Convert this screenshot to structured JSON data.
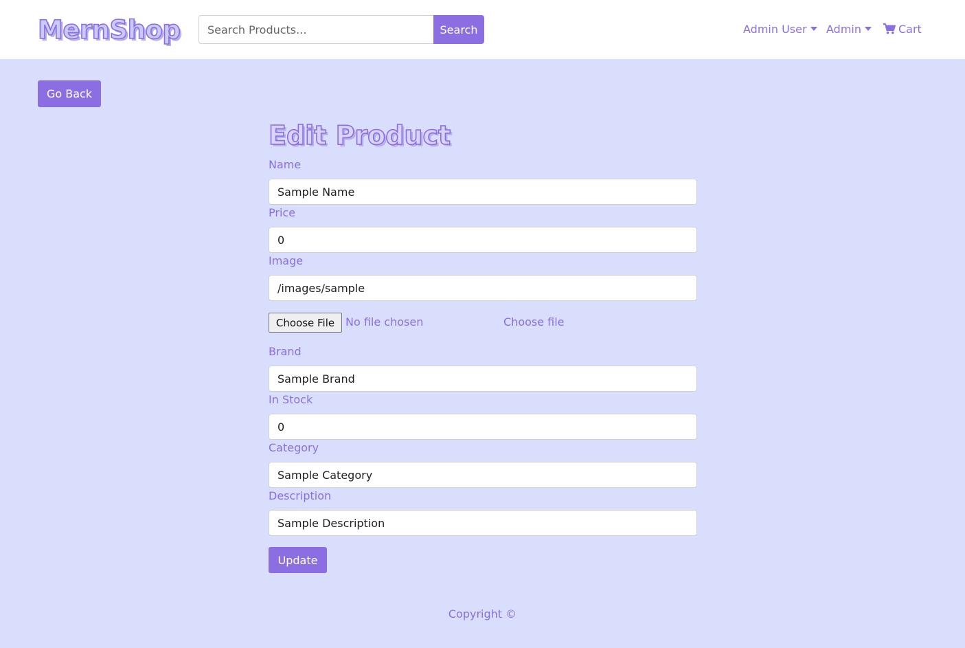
{
  "navbar": {
    "brand": "MernShop",
    "search": {
      "placeholder": "Search Products...",
      "value": "",
      "button_label": "Search"
    },
    "user_menu_label": "Admin User",
    "admin_menu_label": "Admin",
    "cart_label": "Cart",
    "cart_icon": "shopping-cart-icon"
  },
  "main": {
    "go_back_label": "Go Back",
    "title": "Edit Product",
    "form": {
      "name": {
        "label": "Name",
        "value": "Sample Name"
      },
      "price": {
        "label": "Price",
        "value": "0"
      },
      "image": {
        "label": "Image",
        "value": "/images/sample",
        "file_button_label": "Choose File",
        "file_status": "No file chosen",
        "choose_file_label": "Choose file"
      },
      "brand": {
        "label": "Brand",
        "value": "Sample Brand"
      },
      "in_stock": {
        "label": "In Stock",
        "value": "0"
      },
      "category": {
        "label": "Category",
        "value": "Sample Category"
      },
      "description": {
        "label": "Description",
        "value": "Sample Description"
      },
      "submit_label": "Update"
    }
  },
  "footer": {
    "copyright": "Copyright ©"
  },
  "colors": {
    "accent": "#8b6fe2",
    "page_background": "#dadefd",
    "navbar_background": "#ffffff"
  }
}
